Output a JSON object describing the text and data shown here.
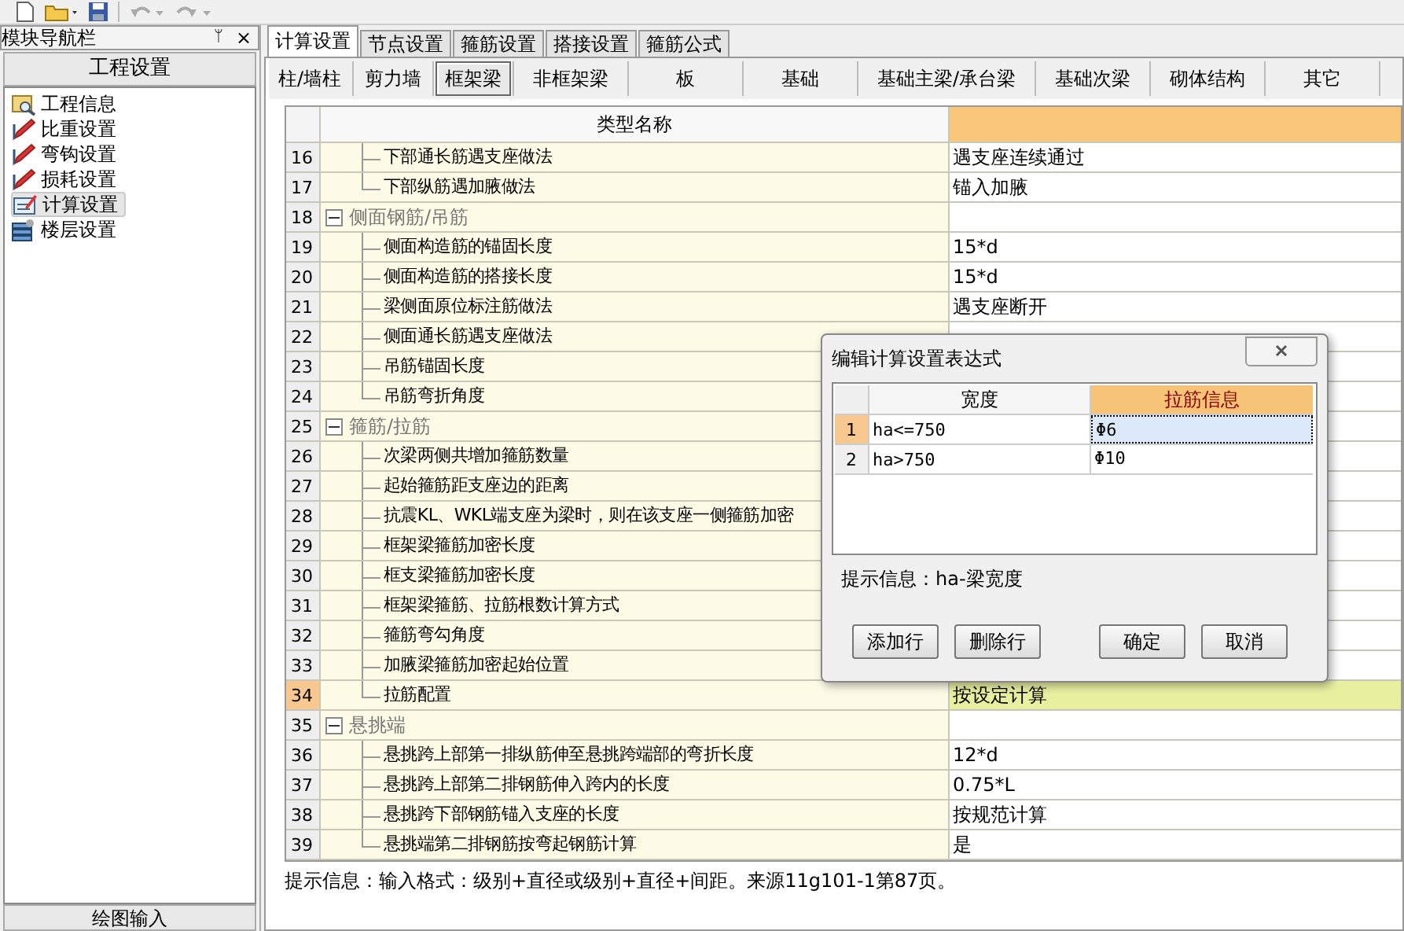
{
  "nav_panel": {
    "title": "模块导航栏",
    "pin": "ᛘ",
    "close": "×",
    "section": "工程设置",
    "items": [
      {
        "label": "工程信息",
        "kind": "info",
        "selected": false
      },
      {
        "label": "比重设置",
        "kind": "edit",
        "selected": false
      },
      {
        "label": "弯钩设置",
        "kind": "edit",
        "selected": false
      },
      {
        "label": "损耗设置",
        "kind": "edit",
        "selected": false
      },
      {
        "label": "计算设置",
        "kind": "form",
        "selected": true
      },
      {
        "label": "楼层设置",
        "kind": "floors",
        "selected": false
      }
    ],
    "bottom_section": "绘图输入"
  },
  "tabs": [
    {
      "label": "计算设置",
      "selected": true
    },
    {
      "label": "节点设置",
      "selected": false
    },
    {
      "label": "箍筋设置",
      "selected": false
    },
    {
      "label": "搭接设置",
      "selected": false
    },
    {
      "label": "箍筋公式",
      "selected": false
    }
  ],
  "sub_tabs": [
    {
      "label": "柱/墙柱",
      "selected": false
    },
    {
      "label": "剪力墙",
      "selected": false
    },
    {
      "label": "框架梁",
      "selected": true
    },
    {
      "label": "非框架梁",
      "selected": false
    },
    {
      "label": "板",
      "selected": false
    },
    {
      "label": "基础",
      "selected": false
    },
    {
      "label": "基础主梁/承台梁",
      "selected": false
    },
    {
      "label": "基础次梁",
      "selected": false
    },
    {
      "label": "砌体结构",
      "selected": false
    },
    {
      "label": "其它",
      "selected": false
    }
  ],
  "table": {
    "columns": [
      "类型名称"
    ],
    "rows": [
      {
        "num": "16",
        "name": "下部通长筋遇支座做法",
        "value": "遇支座连续通过",
        "kind": "item",
        "selected": false
      },
      {
        "num": "17",
        "name": "下部纵筋遇加腋做法",
        "value": "锚入加腋",
        "kind": "item",
        "selected": false
      },
      {
        "num": "18",
        "name": "侧面钢筋/吊筋",
        "kind": "group",
        "expanded": true,
        "children": [
          {
            "num": "19",
            "name": "侧面构造筋的锚固长度",
            "value": "15*d",
            "kind": "item",
            "selected": false
          },
          {
            "num": "20",
            "name": "侧面构造筋的搭接长度",
            "value": "15*d",
            "kind": "item",
            "selected": false
          },
          {
            "num": "21",
            "name": "梁侧面原位标注筋做法",
            "value": "遇支座断开",
            "kind": "item",
            "selected": false
          },
          {
            "num": "22",
            "name": "侧面通长筋遇支座做法",
            "kind": "item",
            "selected": false
          },
          {
            "num": "23",
            "name": "吊筋锚固长度",
            "kind": "item",
            "selected": false
          },
          {
            "num": "24",
            "name": "吊筋弯折角度",
            "kind": "item",
            "selected": false
          }
        ]
      },
      {
        "num": "25",
        "name": "箍筋/拉筋",
        "kind": "group",
        "expanded": true,
        "children": [
          {
            "num": "26",
            "name": "次梁两侧共增加箍筋数量",
            "kind": "item",
            "selected": false
          },
          {
            "num": "27",
            "name": "起始箍筋距支座边的距离",
            "kind": "item",
            "selected": false
          },
          {
            "num": "28",
            "name": "抗震KL、WKL端支座为梁时，则在该支座一侧箍筋加密",
            "kind": "item",
            "selected": false
          },
          {
            "num": "29",
            "name": "框架梁箍筋加密长度",
            "kind": "item",
            "selected": false
          },
          {
            "num": "30",
            "name": "框支梁箍筋加密长度",
            "kind": "item",
            "selected": false
          },
          {
            "num": "31",
            "name": "框架梁箍筋、拉筋根数计算方式",
            "kind": "item",
            "selected": false
          },
          {
            "num": "32",
            "name": "箍筋弯勾角度",
            "kind": "item",
            "selected": false
          },
          {
            "num": "33",
            "name": "加腋梁箍筋加密起始位置",
            "kind": "item",
            "selected": false
          },
          {
            "num": "34",
            "name": "拉筋配置",
            "value": "按设定计算",
            "kind": "item",
            "selected": true
          }
        ]
      },
      {
        "num": "35",
        "name": "悬挑端",
        "kind": "group",
        "expanded": true,
        "children": [
          {
            "num": "36",
            "name": "悬挑跨上部第一排纵筋伸至悬挑跨端部的弯折长度",
            "value": "12*d",
            "kind": "item",
            "selected": false
          },
          {
            "num": "37",
            "name": "悬挑跨上部第二排钢筋伸入跨内的长度",
            "value": "0.75*L",
            "kind": "item",
            "selected": false
          },
          {
            "num": "38",
            "name": "悬挑跨下部钢筋锚入支座的长度",
            "value": "按规范计算",
            "kind": "item",
            "selected": false
          },
          {
            "num": "39",
            "name": "悬挑端第二排钢筋按弯起钢筋计算",
            "value": "是",
            "kind": "item",
            "selected": false
          }
        ]
      }
    ]
  },
  "hint": "提示信息：输入格式：级别+直径或级别+直径+间距。来源11g101-1第87页。",
  "dialog": {
    "title": "编辑计算设置表达式",
    "columns": [
      "宽度",
      "拉筋信息"
    ],
    "rows": [
      {
        "num": "1",
        "width": "ha<=750",
        "info": "Φ6",
        "selected": true
      },
      {
        "num": "2",
        "width": "ha>750",
        "info": "Φ10",
        "selected": false
      }
    ],
    "hint": "提示信息：ha-梁宽度",
    "buttons": [
      "添加行",
      "删除行",
      "确定",
      "取消"
    ]
  }
}
